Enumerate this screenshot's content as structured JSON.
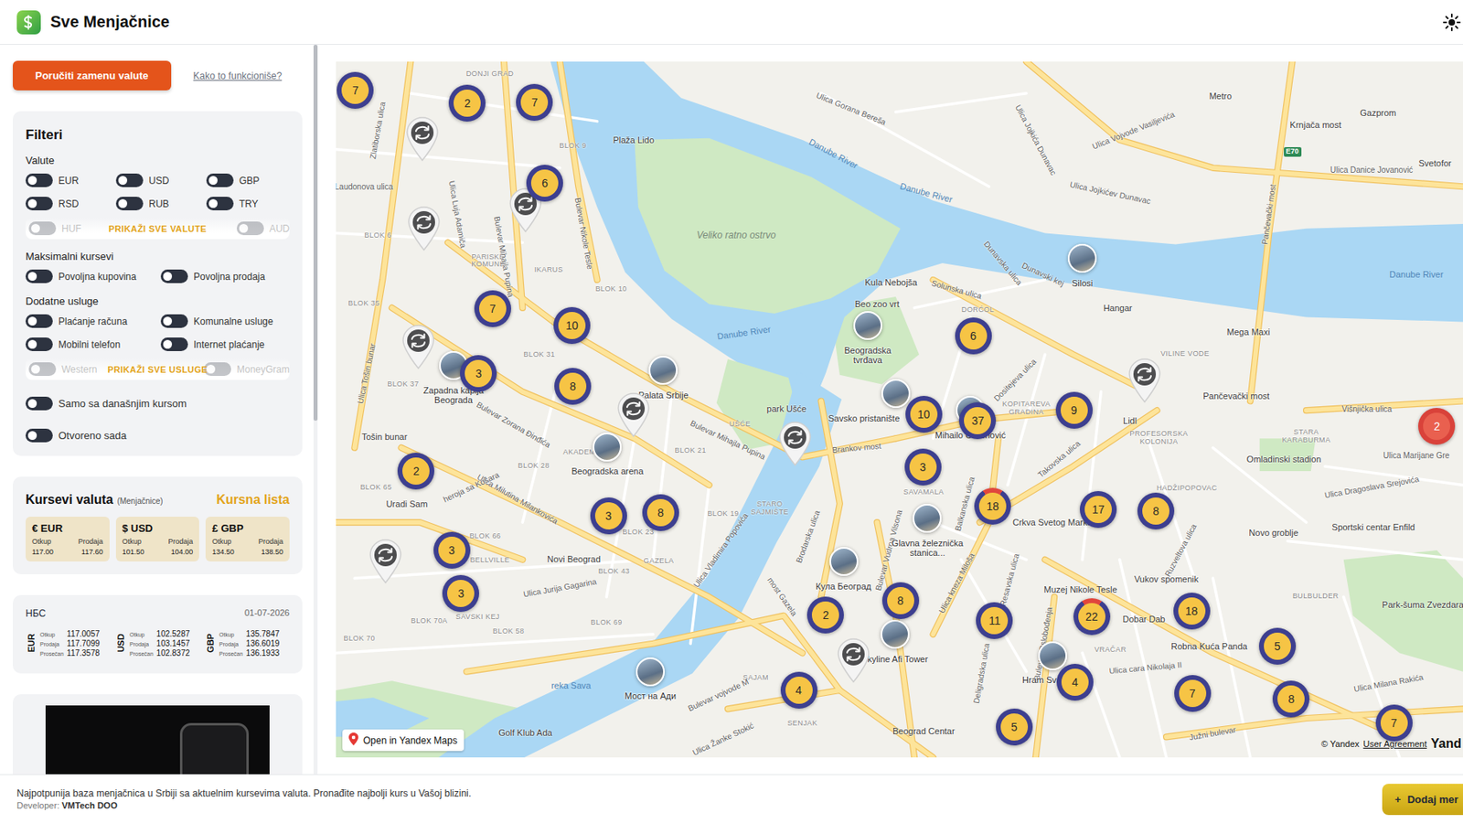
{
  "header": {
    "title": "Sve Menjačnice"
  },
  "actions": {
    "order_button": "Poručiti zamenu valute",
    "how_link": "Kako to funkcioniše?"
  },
  "filters": {
    "title": "Filteri",
    "groups": [
      {
        "title": "Valute",
        "items": [
          {
            "label": "EUR",
            "on": false
          },
          {
            "label": "USD",
            "on": false
          },
          {
            "label": "GBP",
            "on": false
          },
          {
            "label": "RSD",
            "on": false
          },
          {
            "label": "RUB",
            "on": false
          },
          {
            "label": "TRY",
            "on": false
          }
        ],
        "faded": [
          {
            "label": "HUF",
            "on": false
          },
          {
            "label": "AUD",
            "on": false
          }
        ],
        "more": "PRIKAŽI SVE VALUTE"
      },
      {
        "title": "Maksimalni kursevi",
        "items": [
          {
            "label": "Povoljna kupovina",
            "on": false
          },
          {
            "label": "Povoljna prodaja",
            "on": false
          }
        ]
      },
      {
        "title": "Dodatne usluge",
        "items": [
          {
            "label": "Plaćanje računa",
            "on": false
          },
          {
            "label": "Komunalne usluge",
            "on": false
          },
          {
            "label": "Mobilni telefon",
            "on": false
          },
          {
            "label": "Internet plaćanje",
            "on": false
          }
        ],
        "faded": [
          {
            "label": "Western",
            "on": false
          },
          {
            "label": "MoneyGram",
            "on": false
          }
        ],
        "more": "PRIKAŽI SVE USLUGE"
      }
    ],
    "standalone": [
      {
        "label": "Samo sa današnjim kursom",
        "on": false
      },
      {
        "label": "Otvoreno sada",
        "on": false
      }
    ]
  },
  "rates": {
    "title": "Kursevi valuta",
    "subtitle": "(Menjačnice)",
    "link": "Kursna lista",
    "tiles": [
      {
        "symbol": "€",
        "code": "EUR",
        "buy_label": "Otkup",
        "sell_label": "Prodaja",
        "buy": "117.00",
        "sell": "117.60"
      },
      {
        "symbol": "$",
        "code": "USD",
        "buy_label": "Otkup",
        "sell_label": "Prodaja",
        "buy": "101.50",
        "sell": "104.00"
      },
      {
        "symbol": "£",
        "code": "GBP",
        "buy_label": "Otkup",
        "sell_label": "Prodaja",
        "buy": "134.50",
        "sell": "138.50"
      }
    ]
  },
  "nbs": {
    "title": "НБС",
    "date": "01-07-2026",
    "rows": [
      {
        "code": "EUR",
        "lines": [
          {
            "label": "Otkup",
            "value": "117.0057"
          },
          {
            "label": "Prodaja",
            "value": "117.7099"
          },
          {
            "label": "Prosečan",
            "value": "117.3578"
          }
        ]
      },
      {
        "code": "USD",
        "lines": [
          {
            "label": "Otkup",
            "value": "102.5287"
          },
          {
            "label": "Prodaja",
            "value": "103.1457"
          },
          {
            "label": "Prosečan",
            "value": "102.8372"
          }
        ]
      },
      {
        "code": "GBP",
        "lines": [
          {
            "label": "Otkup",
            "value": "135.7847"
          },
          {
            "label": "Prodaja",
            "value": "136.6019"
          },
          {
            "label": "Prosečan",
            "value": "136.1933"
          }
        ]
      }
    ]
  },
  "map": {
    "clusters": [
      {
        "count": "7",
        "kind": "normal"
      },
      {
        "count": "2",
        "kind": "normal"
      },
      {
        "count": "7",
        "kind": "normal"
      },
      {
        "count": "6",
        "kind": "normal"
      },
      {
        "count": "7",
        "kind": "normal"
      },
      {
        "count": "10",
        "kind": "normal"
      },
      {
        "count": "3",
        "kind": "normal"
      },
      {
        "count": "8",
        "kind": "normal"
      },
      {
        "count": "2",
        "kind": "normal"
      },
      {
        "count": "3",
        "kind": "normal"
      },
      {
        "count": "3",
        "kind": "normal"
      },
      {
        "count": "3",
        "kind": "normal"
      },
      {
        "count": "8",
        "kind": "normal"
      },
      {
        "count": "2",
        "kind": "normal"
      },
      {
        "count": "4",
        "kind": "normal"
      },
      {
        "count": "8",
        "kind": "normal"
      },
      {
        "count": "5",
        "kind": "normal"
      },
      {
        "count": "6",
        "kind": "normal"
      },
      {
        "count": "10",
        "kind": "normal"
      },
      {
        "count": "37",
        "kind": "normal"
      },
      {
        "count": "3",
        "kind": "normal"
      },
      {
        "count": "18",
        "kind": "partial"
      },
      {
        "count": "9",
        "kind": "normal"
      },
      {
        "count": "17",
        "kind": "normal"
      },
      {
        "count": "8",
        "kind": "normal"
      },
      {
        "count": "11",
        "kind": "normal"
      },
      {
        "count": "22",
        "kind": "partial"
      },
      {
        "count": "4",
        "kind": "normal"
      },
      {
        "count": "18",
        "kind": "normal"
      },
      {
        "count": "7",
        "kind": "normal"
      },
      {
        "count": "5",
        "kind": "normal"
      },
      {
        "count": "8",
        "kind": "normal"
      },
      {
        "count": "7",
        "kind": "normal"
      },
      {
        "count": "2",
        "kind": "red"
      }
    ],
    "landmarks": [
      {
        "label": "Zapadna kapija Beograda"
      },
      {
        "label": "Palata Srbije"
      },
      {
        "label": "Beogradska arena"
      },
      {
        "label": "Beogradska tvrđava"
      },
      {
        "label": "Savsko pristanište"
      },
      {
        "label": "Mihailo Obrenović"
      },
      {
        "label": "Silosi"
      },
      {
        "label": "Glavna železnička stanica..."
      },
      {
        "label": "Кула Београд"
      },
      {
        "label": "Skyline Afi Tower"
      },
      {
        "label": "Мост на Ади"
      },
      {
        "label": "Hram Sv"
      }
    ],
    "labels": [
      {
        "text": "DONJI GRAD",
        "kind": "district"
      },
      {
        "text": "Plaža Lido",
        "kind": "poi"
      },
      {
        "text": "Ulica Gorana Bereša",
        "kind": "street"
      },
      {
        "text": "Ulica Jojkića Dunavac",
        "kind": "street"
      },
      {
        "text": "Ulica Jojkićev Dunavac",
        "kind": "street"
      },
      {
        "text": "Ulica Vojvode Vasiljevića",
        "kind": "street"
      },
      {
        "text": "Danube River",
        "kind": "water"
      },
      {
        "text": "Danube River",
        "kind": "water"
      },
      {
        "text": "Danube River",
        "kind": "water"
      },
      {
        "text": "Danube River",
        "kind": "water"
      },
      {
        "text": "Veliko ratno ostrvo",
        "kind": "area"
      },
      {
        "text": "Metro",
        "kind": "poi"
      },
      {
        "text": "Krnjača most",
        "kind": "poi"
      },
      {
        "text": "Gazprom",
        "kind": "poi"
      },
      {
        "text": "Ulica Danice Jovanović",
        "kind": "street"
      },
      {
        "text": "Svetofor",
        "kind": "poi"
      },
      {
        "text": "Pančevački most",
        "kind": "street"
      },
      {
        "text": "Pančevački most",
        "kind": "poi"
      },
      {
        "text": "Mega Maxi",
        "kind": "poi"
      },
      {
        "text": "Hangar",
        "kind": "poi"
      },
      {
        "text": "Dunavski kej",
        "kind": "street"
      },
      {
        "text": "Dunavska ulica",
        "kind": "street"
      },
      {
        "text": "Kula Nebojša",
        "kind": "poi"
      },
      {
        "text": "Beo zoo vrt",
        "kind": "poi"
      },
      {
        "text": "Solunska ulica",
        "kind": "street"
      },
      {
        "text": "DORĆOL",
        "kind": "district"
      },
      {
        "text": "VILINE VODE",
        "kind": "district"
      },
      {
        "text": "Dositejeva ulica",
        "kind": "street"
      },
      {
        "text": "Lidl",
        "kind": "poi"
      },
      {
        "text": "PROFESORSKA KOLONIJA",
        "kind": "district"
      },
      {
        "text": "Višnjička ulica",
        "kind": "street"
      },
      {
        "text": "STARA KARABURMA",
        "kind": "district"
      },
      {
        "text": "Omladinski stadion",
        "kind": "poi"
      },
      {
        "text": "Ulica Marijane Gre",
        "kind": "street"
      },
      {
        "text": "Ulica Dragoslava Srejovića",
        "kind": "street"
      },
      {
        "text": "Sportski centar Enfild",
        "kind": "poi"
      },
      {
        "text": "Novo groblje",
        "kind": "poi"
      },
      {
        "text": "Park-šuma Zvezdara",
        "kind": "poi"
      },
      {
        "text": "Takovska ulica",
        "kind": "street"
      },
      {
        "text": "Crkva Svetog Marka",
        "kind": "poi"
      },
      {
        "text": "HADŽIPOPOVAC",
        "kind": "district"
      },
      {
        "text": "Ruzveltova ulica",
        "kind": "street"
      },
      {
        "text": "Vukov spomenik",
        "kind": "poi"
      },
      {
        "text": "Dobar Dab",
        "kind": "poi"
      },
      {
        "text": "Robna Kuća Panda",
        "kind": "poi"
      },
      {
        "text": "BULBULDER",
        "kind": "district"
      },
      {
        "text": "Ulica Milana Rakića",
        "kind": "street"
      },
      {
        "text": "Muzej Nikole Tesle",
        "kind": "poi"
      },
      {
        "text": "VRAČAR",
        "kind": "district"
      },
      {
        "text": "Ulica cara Nikolaja II",
        "kind": "street"
      },
      {
        "text": "Južni bulevar",
        "kind": "street"
      },
      {
        "text": "KOPITAREVA GRADINA",
        "kind": "district"
      },
      {
        "text": "SAVAMALA",
        "kind": "district"
      },
      {
        "text": "Balkanska ulica",
        "kind": "street"
      },
      {
        "text": "Bulevar Vudroa Vilsona",
        "kind": "street"
      },
      {
        "text": "Ulica kneza Miloša",
        "kind": "street"
      },
      {
        "text": "Resavska ulica",
        "kind": "street"
      },
      {
        "text": "Bulevar Oslobođenja",
        "kind": "street"
      },
      {
        "text": "Deligradska ulica",
        "kind": "street"
      },
      {
        "text": "Beograd Centar",
        "kind": "poi"
      },
      {
        "text": "SENJAK",
        "kind": "district"
      },
      {
        "text": "SAJAM",
        "kind": "district"
      },
      {
        "text": "Bulevar vojvode M",
        "kind": "street"
      },
      {
        "text": "Ulica Žanke Stokić",
        "kind": "street"
      },
      {
        "text": "most Gazela",
        "kind": "street"
      },
      {
        "text": "Brankov most",
        "kind": "street"
      },
      {
        "text": "park Ušće",
        "kind": "poi"
      },
      {
        "text": "UŠĆE",
        "kind": "district"
      },
      {
        "text": "Brodarska ulica",
        "kind": "street"
      },
      {
        "text": "STARO SAJMIŠTE",
        "kind": "district"
      },
      {
        "text": "Bulevar Mihajla Pupina",
        "kind": "street"
      },
      {
        "text": "AKADEMIJA",
        "kind": "district"
      },
      {
        "text": "BLOK 21",
        "kind": "district"
      },
      {
        "text": "BLOK 28",
        "kind": "district"
      },
      {
        "text": "BLOK 31",
        "kind": "district"
      },
      {
        "text": "BLOK 19",
        "kind": "district"
      },
      {
        "text": "BLOK 23",
        "kind": "district"
      },
      {
        "text": "GAZELA",
        "kind": "district"
      },
      {
        "text": "Novi Beograd",
        "kind": "poi"
      },
      {
        "text": "BLOK 43",
        "kind": "district"
      },
      {
        "text": "Ulica Jurija Gagarina",
        "kind": "street"
      },
      {
        "text": "BLOK 69",
        "kind": "district"
      },
      {
        "text": "BLOK 58",
        "kind": "district"
      },
      {
        "text": "BLOK 70A",
        "kind": "district"
      },
      {
        "text": "BLOK 70",
        "kind": "district"
      },
      {
        "text": "SAVSKI KEJ",
        "kind": "district"
      },
      {
        "text": "BELLVILLE",
        "kind": "district"
      },
      {
        "text": "BLOK 66",
        "kind": "district"
      },
      {
        "text": "BLOK 65",
        "kind": "district"
      },
      {
        "text": "Uradi Sam",
        "kind": "poi"
      },
      {
        "text": "Tošin bunar",
        "kind": "poi"
      },
      {
        "text": "Ulica Tošin bunar",
        "kind": "street"
      },
      {
        "text": "BLOK 37",
        "kind": "district"
      },
      {
        "text": "BLOK 35",
        "kind": "district"
      },
      {
        "text": "BLOK 6",
        "kind": "district"
      },
      {
        "text": "PARISKE KOMUNE",
        "kind": "district"
      },
      {
        "text": "IKARUS",
        "kind": "district"
      },
      {
        "text": "BLOK 9",
        "kind": "district"
      },
      {
        "text": "BLOK 10",
        "kind": "district"
      },
      {
        "text": "Bulevar Mihajla Pupina",
        "kind": "street"
      },
      {
        "text": "Bulevar Nikole Tesle",
        "kind": "street"
      },
      {
        "text": "Ulica Luja Adamiča",
        "kind": "street"
      },
      {
        "text": "Zlatiborska ulica",
        "kind": "street"
      },
      {
        "text": "Laudonova ulica",
        "kind": "street"
      },
      {
        "text": "Bulevar Zorana Đinđića",
        "kind": "street"
      },
      {
        "text": "Ulica Milutina Milankovića",
        "kind": "street"
      },
      {
        "text": "Ulica Vladimira Popovića",
        "kind": "street"
      },
      {
        "text": "heroja sa Košara",
        "kind": "street"
      },
      {
        "text": "reka Sava",
        "kind": "water"
      },
      {
        "text": "Golf Klub Ada",
        "kind": "poi"
      },
      {
        "text": "E70",
        "kind": "badge"
      }
    ],
    "open_link": "Open in Yandex Maps",
    "copyright": "© Yandex",
    "agreement": "User Agreement",
    "brand": "Yand"
  },
  "footer": {
    "text": "Najpotpunija baza menjačnica u Srbiji sa aktuelnim kursevima valuta. Pronađite najbolji kurs u Vašoj blizini.",
    "developer_label": "Developer:",
    "developer": "VMTech DOO",
    "add_icon": "+",
    "add_button": "Dodaj mer"
  }
}
